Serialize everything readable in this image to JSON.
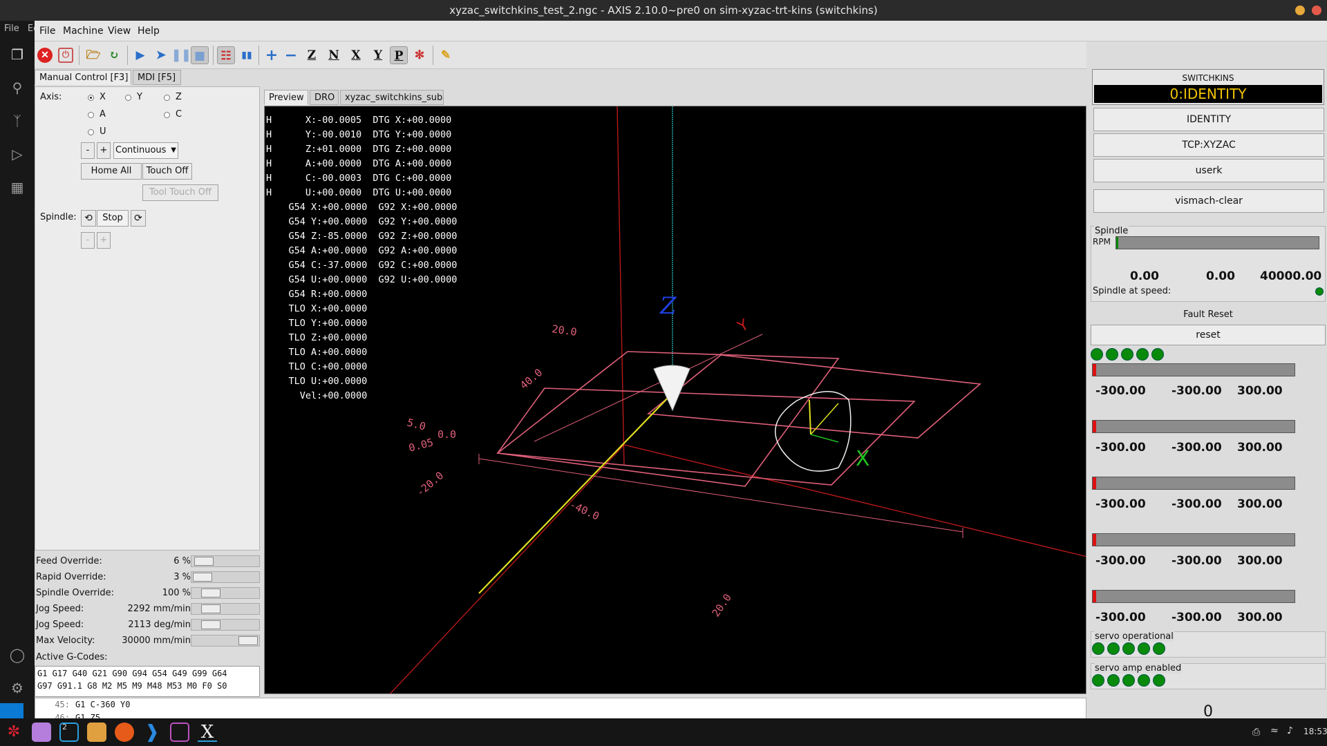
{
  "window": {
    "title": "xyzac_switchkins_test_2.ngc - AXIS 2.10.0~pre0 on sim-xyzac-trt-kins (switchkins)"
  },
  "host_menu": [
    "File",
    "Ed"
  ],
  "menubar": {
    "items": [
      "File",
      "Machine",
      "View",
      "Help"
    ]
  },
  "toolbar": {
    "icons": [
      "estop-icon",
      "power-icon",
      "open-icon",
      "reload-icon",
      "run-icon",
      "step-icon",
      "pause-icon",
      "stop-icon",
      "block-delete-icon",
      "optional-stop-icon",
      "zoom-in-icon",
      "zoom-out-icon",
      "view-z-icon",
      "view-z2-icon",
      "view-x-icon",
      "view-y-icon",
      "view-p-icon",
      "rotate-icon",
      "clear-plot-icon"
    ]
  },
  "left_tabs": [
    "Manual Control [F3]",
    "MDI [F5]"
  ],
  "preview_tabs": [
    "Preview",
    "DRO",
    "xyzac_switchkins_sub"
  ],
  "manual": {
    "axis_label": "Axis:",
    "axes": [
      "X",
      "Y",
      "Z",
      "A",
      "C",
      "U"
    ],
    "selected_axis": "X",
    "minus": "-",
    "plus": "+",
    "jog_mode": "Continuous",
    "home_all": "Home All",
    "touch_off": "Touch Off",
    "tool_touch_off": "Tool Touch Off",
    "spindle_label": "Spindle:",
    "spindle_stop": "Stop"
  },
  "overrides": [
    {
      "name": "Feed Override:",
      "value": "6 %",
      "level": 0.06
    },
    {
      "name": "Rapid Override:",
      "value": "3 %",
      "level": 0.03
    },
    {
      "name": "Spindle Override:",
      "value": "100 %",
      "level": 0.2
    },
    {
      "name": "Jog Speed:",
      "value": "2292 mm/min",
      "level": 0.2
    },
    {
      "name": "Jog Speed:",
      "value": "2113 deg/min",
      "level": 0.2
    },
    {
      "name": "Max Velocity:",
      "value": "30000 mm/min",
      "level": 1.0
    }
  ],
  "active_gcodes_label": "Active G-Codes:",
  "active_gcodes": [
    "G1 G17 G40 G21 G90 G94 G54 G49 G99 G64",
    "G97 G91.1 G8 M2 M5 M9 M48 M53 M0 F0 S0"
  ],
  "dro_lines": [
    "H      X:-00.0005  DTG X:+00.0000",
    "H      Y:-00.0010  DTG Y:+00.0000",
    "H      Z:+01.0000  DTG Z:+00.0000",
    "H      A:+00.0000  DTG A:+00.0000",
    "H      C:-00.0003  DTG C:+00.0000",
    "H      U:+00.0000  DTG U:+00.0000",
    "    G54 X:+00.0000  G92 X:+00.0000",
    "    G54 Y:+00.0000  G92 Y:+00.0000",
    "    G54 Z:-85.0000  G92 Z:+00.0000",
    "    G54 A:+00.0000  G92 A:+00.0000",
    "    G54 C:-37.0000  G92 C:+00.0000",
    "    G54 U:+00.0000  G92 U:+00.0000",
    "    G54 R:+00.0000",
    "    TLO X:+00.0000",
    "    TLO Y:+00.0000",
    "    TLO Z:+00.0000",
    "    TLO A:+00.0000",
    "    TLO C:+00.0000",
    "    TLO U:+00.0000",
    "      Vel:+00.0000"
  ],
  "preview_labels": {
    "z": "Z",
    "y": "Y",
    "x": "X",
    "dims": [
      "20.0",
      "40.0",
      "5.0",
      "0.0",
      "0.05",
      "-20.0",
      "-40.0",
      "20.0"
    ]
  },
  "program_lines": [
    {
      "num": "45:",
      "code": "G1 C-360 Y0"
    },
    {
      "num": "46:",
      "code": "G1 Z5"
    },
    {
      "num": "47:",
      "code": ""
    }
  ],
  "right": {
    "switchkins_label": "SWITCHKINS",
    "switchkins_value": "0:IDENTITY",
    "buttons": [
      "IDENTITY",
      "TCP:XYZAC",
      "userk"
    ],
    "vismach_clear": "vismach-clear",
    "spindle_frame": "Spindle",
    "rpm_label": "RPM",
    "rpm_values": [
      "0.00",
      "0.00",
      "40000.00"
    ],
    "rpm_level": 0.0,
    "spindle_at_speed": "Spindle at speed:",
    "fault_reset_label": "Fault Reset",
    "reset_button": "reset",
    "bars": [
      {
        "labels": [
          "-300.00",
          "-300.00",
          "300.00"
        ]
      },
      {
        "labels": [
          "-300.00",
          "-300.00",
          "300.00"
        ]
      },
      {
        "labels": [
          "-300.00",
          "-300.00",
          "300.00"
        ]
      },
      {
        "labels": [
          "-300.00",
          "-300.00",
          "300.00"
        ]
      },
      {
        "labels": [
          "-300.00",
          "-300.00",
          "300.00"
        ]
      }
    ],
    "servo_operational": "servo operational",
    "servo_amp_enabled": "servo amp enabled",
    "counter1": "0",
    "counter2": "0"
  },
  "colors": {
    "led_on": "#0a8a0a",
    "bar_fill": "#d11111",
    "dro_text": "#ffffff",
    "preview_bg": "#000000",
    "limit_box": "#e0607a",
    "tool_path": "#e0e020"
  },
  "taskbar": {
    "badge": "2",
    "clock": "18:53"
  }
}
